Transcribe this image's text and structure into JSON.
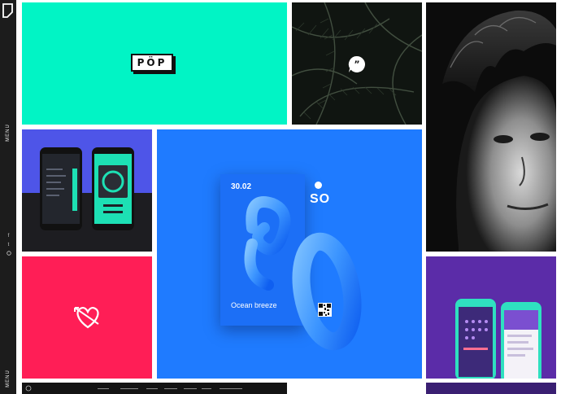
{
  "sidebar": {
    "menu_top": "MENU",
    "menu_bottom": "MENU",
    "social_icons": [
      "facebook-icon",
      "twitter-icon",
      "dribbble-icon"
    ]
  },
  "tiles": {
    "pop": {
      "brand": "PÖP",
      "bg": "#01f4c5"
    },
    "ferns": {
      "icon": "speech-bubble-quote-icon"
    },
    "phones_a": {
      "bg_top": "#4e55e8",
      "bg_bottom": "#1d1d21"
    },
    "heart": {
      "bg": "#ff1e56",
      "icon": "heart-arrow-icon"
    },
    "ocean": {
      "bg": "#1f7bff",
      "date": "30.02",
      "so": "SO",
      "title": "Ocean breeze"
    },
    "phones_b": {
      "bg": "#5b2ca8"
    }
  },
  "colors": {
    "sidebar": "#1c1c1c",
    "accent_teal": "#01f4c5",
    "blue": "#1f7bff",
    "pink": "#ff1e56"
  }
}
